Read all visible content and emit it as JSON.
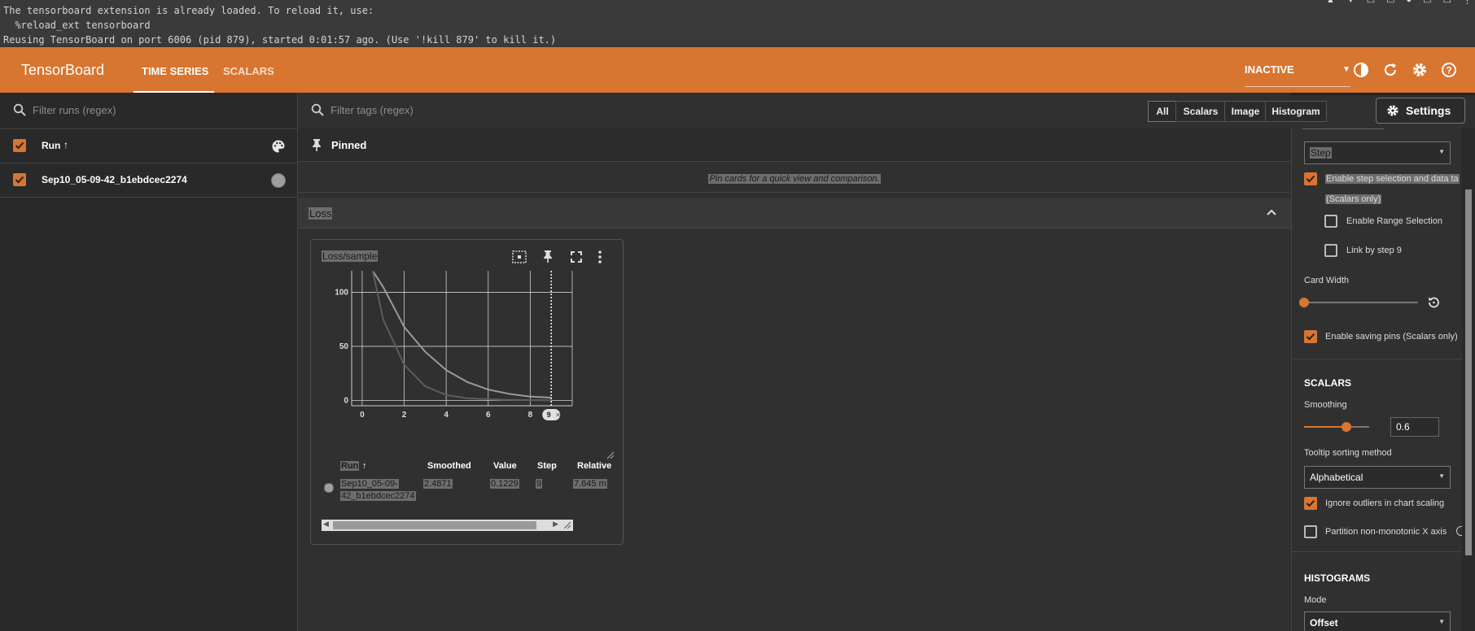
{
  "console": {
    "lines": [
      "The tensorboard extension is already loaded. To reload it, use:",
      "  %reload_ext tensorboard",
      "Reusing TensorBoard on port 6006 (pid 879), started 0:01:57 ago. (Use '!kill 879' to kill it.)"
    ]
  },
  "header": {
    "brand": "TensorBoard",
    "tabs": [
      "TIME SERIES",
      "SCALARS"
    ],
    "status": "INACTIVE",
    "accent": "#d87530"
  },
  "runs": {
    "filter_placeholder": "Filter runs (regex)",
    "header": "Run",
    "sort_indicator": "↑",
    "items": [
      {
        "name": "Sep10_05-09-42_b1ebdcec2274",
        "color": "#9e9e9e"
      }
    ]
  },
  "main": {
    "filter_placeholder": "Filter tags (regex)",
    "chips": [
      "All",
      "Scalars",
      "Image",
      "Histogram"
    ],
    "settings_label": "Settings",
    "pinned_label": "Pinned",
    "pinned_message": "Pin cards for a quick view and comparison.",
    "group_label": "Loss"
  },
  "card": {
    "title": "Loss/sample",
    "step_marker": "9",
    "table": {
      "headers": [
        "Run",
        "Smoothed",
        "Value",
        "Step",
        "Relative"
      ],
      "row": {
        "run_line1": "Sep10_05-09-",
        "run_line2": "42_b1ebdcec2274",
        "smoothed": "2.4871",
        "value": "0.1229",
        "step": "9",
        "relative": "7.645 m"
      }
    }
  },
  "chart_data": {
    "type": "line",
    "title": "Loss/sample",
    "x_ticks": [
      "0",
      "2",
      "4",
      "6",
      "8"
    ],
    "y_ticks": [
      "0",
      "50",
      "100"
    ],
    "xlim": [
      -0.5,
      10
    ],
    "ylim": [
      -5,
      120
    ],
    "grid": true,
    "series": [
      {
        "name": "smoothed",
        "color": "#9a9a9a",
        "x": [
          0.5,
          1,
          2,
          3,
          4,
          5,
          6,
          7,
          8,
          9
        ],
        "y": [
          120,
          105,
          68,
          45,
          28,
          17,
          10,
          6,
          3.5,
          2.5
        ]
      },
      {
        "name": "value",
        "color": "#5c5c5c",
        "x": [
          0.5,
          1,
          2,
          3,
          4,
          5,
          6,
          7,
          8,
          9
        ],
        "y": [
          120,
          75,
          33,
          13,
          5,
          2,
          1,
          0.5,
          0.3,
          0.12
        ]
      }
    ]
  },
  "settings_panel": {
    "horizontal_axis_value": "Step",
    "step_selection": "Enable step selection and data ta",
    "step_selection_sub": "(Scalars only)",
    "range_selection": "Enable Range Selection",
    "link_step": "Link by step 9",
    "card_width": "Card Width",
    "saving_pins": "Enable saving pins (Scalars only)",
    "scalars_heading": "SCALARS",
    "smoothing_label": "Smoothing",
    "smoothing_value": "0.6",
    "tooltip_label": "Tooltip sorting method",
    "tooltip_value": "Alphabetical",
    "ignore_outliers": "Ignore outliers in chart scaling",
    "partition": "Partition non-monotonic X axis",
    "histograms_heading": "HISTOGRAMS",
    "mode_label": "Mode",
    "mode_value": "Offset"
  }
}
